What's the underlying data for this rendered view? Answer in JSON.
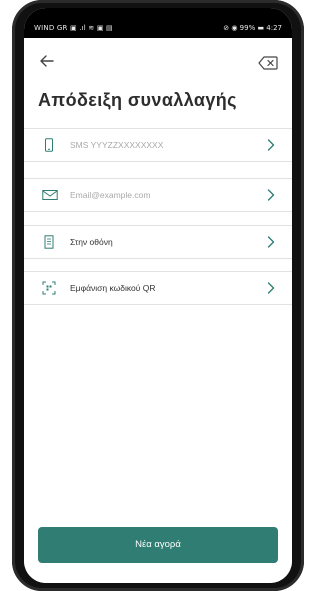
{
  "status_bar": {
    "left_text": "WIND GR ▣ .ıl ≋ ▣ ▤",
    "right_text": "⊘ ◉ 99% ▬ 4:27"
  },
  "header": {
    "back_icon": "arrow-left-icon",
    "clear_icon": "backspace-x-icon",
    "title": "Απόδειξη συναλλαγής"
  },
  "options": [
    {
      "label": "SMS YYYZZXXXXXXXX",
      "placeholder": true,
      "icon": "phone-icon"
    },
    {
      "label": "Email@example.com",
      "placeholder": true,
      "icon": "envelope-icon"
    },
    {
      "label": "Στην οθόνη",
      "placeholder": false,
      "icon": "receipt-icon"
    },
    {
      "label": "Εμφάνιση κωδικού QR",
      "placeholder": false,
      "icon": "qr-code-icon"
    }
  ],
  "cta": {
    "label": "Νέα αγορά"
  },
  "colors": {
    "accent": "#2f7d73",
    "chevron": "#2f7d73",
    "title": "#2d2d2d",
    "placeholder": "#a9a9a9"
  }
}
